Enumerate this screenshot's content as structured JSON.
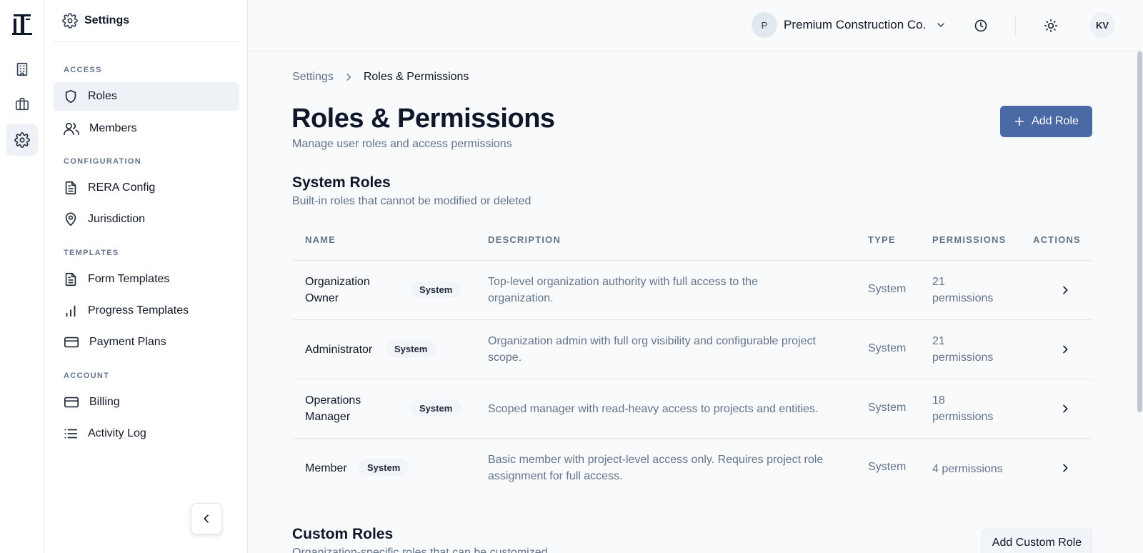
{
  "rail": {
    "items": [
      {
        "icon": "building-icon"
      },
      {
        "icon": "briefcase-icon"
      },
      {
        "icon": "gear-icon",
        "active": true
      }
    ]
  },
  "sidebar": {
    "title": "Settings",
    "sections": [
      {
        "label": "ACCESS",
        "items": [
          {
            "label": "Roles",
            "icon": "shield-icon",
            "active": true
          },
          {
            "label": "Members",
            "icon": "users-icon"
          }
        ]
      },
      {
        "label": "CONFIGURATION",
        "items": [
          {
            "label": "RERA Config",
            "icon": "document-icon"
          },
          {
            "label": "Jurisdiction",
            "icon": "map-pin-icon"
          }
        ]
      },
      {
        "label": "TEMPLATES",
        "items": [
          {
            "label": "Form Templates",
            "icon": "document-icon"
          },
          {
            "label": "Progress Templates",
            "icon": "bar-chart-icon"
          },
          {
            "label": "Payment Plans",
            "icon": "credit-card-icon"
          }
        ]
      },
      {
        "label": "ACCOUNT",
        "items": [
          {
            "label": "Billing",
            "icon": "credit-card-icon"
          },
          {
            "label": "Activity Log",
            "icon": "list-icon"
          }
        ]
      }
    ]
  },
  "header": {
    "org_initial": "P",
    "org_name": "Premium Construction Co.",
    "user_initials": "KV"
  },
  "breadcrumb": {
    "parent": "Settings",
    "current": "Roles & Permissions"
  },
  "page": {
    "title": "Roles & Permissions",
    "subtitle": "Manage user roles and access permissions",
    "add_role_label": "Add Role"
  },
  "system_roles": {
    "title": "System Roles",
    "subtitle": "Built-in roles that cannot be modified or deleted",
    "columns": {
      "name": "NAME",
      "description": "DESCRIPTION",
      "type": "TYPE",
      "permissions": "PERMISSIONS",
      "actions": "ACTIONS"
    },
    "rows": [
      {
        "name_line1": "Organization",
        "name_line2": "Owner",
        "badge": "System",
        "desc_line1": "Top-level organization authority with full access to the",
        "desc_line2": "organization.",
        "type": "System",
        "perm_line1": "21",
        "perm_line2": "permissions"
      },
      {
        "name_line1": "Administrator",
        "name_line2": "",
        "badge": "System",
        "desc_line1": "Organization admin with full org visibility and configurable project",
        "desc_line2": "scope.",
        "type": "System",
        "perm_line1": "21",
        "perm_line2": "permissions"
      },
      {
        "name_line1": "Operations",
        "name_line2": "Manager",
        "badge": "System",
        "desc_line1": "Scoped manager with read-heavy access to projects and entities.",
        "desc_line2": "",
        "type": "System",
        "perm_line1": "18",
        "perm_line2": "permissions"
      },
      {
        "name_line1": "Member",
        "name_line2": "",
        "badge": "System",
        "desc_line1": "Basic member with project-level access only. Requires project role",
        "desc_line2": "assignment for full access.",
        "type": "System",
        "perm_line1": "4 permissions",
        "perm_line2": ""
      }
    ]
  },
  "custom_roles": {
    "title": "Custom Roles",
    "subtitle": "Organization-specific roles that can be customized",
    "add_label": "Add Custom Role"
  },
  "colors": {
    "accent": "#4b6aa5",
    "muted_text": "#64748b",
    "border": "#e5e7eb"
  }
}
